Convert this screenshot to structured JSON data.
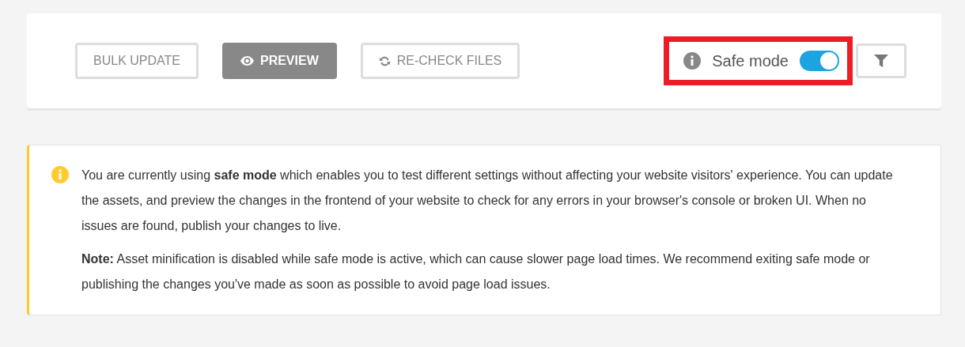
{
  "toolbar": {
    "buttons": [
      {
        "label": "BULK UPDATE",
        "kind": "plain"
      },
      {
        "label": "PREVIEW",
        "kind": "preview"
      },
      {
        "label": "RE-CHECK FILES",
        "kind": "recheck"
      }
    ],
    "safe_mode": {
      "label": "Safe mode",
      "on": true,
      "highlighted": true
    },
    "filter_button": {
      "kind": "filter"
    }
  },
  "notice": {
    "paragraphs": [
      "You are currently using **safe mode** which enables you to test different settings without affecting your website visitors' experience. You can update the assets, and preview the changes in the frontend of your website to check for any errors in your browser's console or broken UI. When no issues are found, publish your changes to live.",
      "**Note:** Asset minification is disabled while safe mode is active, which can cause slower page load times. We recommend exiting safe mode or publishing the changes you've made as soon as possible to avoid page load issues."
    ]
  }
}
